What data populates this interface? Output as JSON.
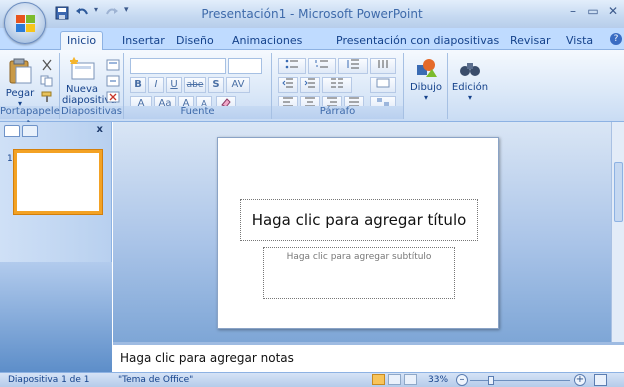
{
  "window": {
    "title": "Presentación1 - Microsoft PowerPoint",
    "minimize": "–",
    "maximize": "▭",
    "close": "✕"
  },
  "tabs": [
    "Inicio",
    "Insertar",
    "Diseño",
    "Animaciones",
    "Presentación con diapositivas",
    "Revisar",
    "Vista"
  ],
  "ribbon": {
    "portapapeles": {
      "label": "Portapapeles",
      "paste": "Pegar"
    },
    "diapositivas": {
      "label": "Diapositivas",
      "new_slide_line1": "Nueva",
      "new_slide_line2": "diapositiva ▾"
    },
    "fuente": {
      "label": "Fuente",
      "bold": "B",
      "italic": "I",
      "underline": "U",
      "strike": "abe",
      "shadow": "S",
      "spacing": "AV",
      "case": "Aa",
      "grow": "A",
      "shrink": "A"
    },
    "parrafo": {
      "label": "Párrafo"
    },
    "dibujo": {
      "label": "Dibujo"
    },
    "edicion": {
      "label": "Edición"
    }
  },
  "slides_panel": {
    "thumbnail_number": "1",
    "close": "x"
  },
  "slide": {
    "title_placeholder": "Haga clic para agregar título",
    "subtitle_placeholder": "Haga clic para agregar subtítulo"
  },
  "notes": {
    "placeholder": "Haga clic para agregar notas"
  },
  "status": {
    "slide_info": "Diapositiva 1 de 1",
    "theme": "\"Tema de Office\"",
    "zoom": "33%",
    "zoom_out": "–",
    "zoom_in": "+"
  },
  "colors": {
    "accent": "#15428b",
    "ribbon_bg": "#dbe8f8",
    "selection": "#f3a224"
  }
}
